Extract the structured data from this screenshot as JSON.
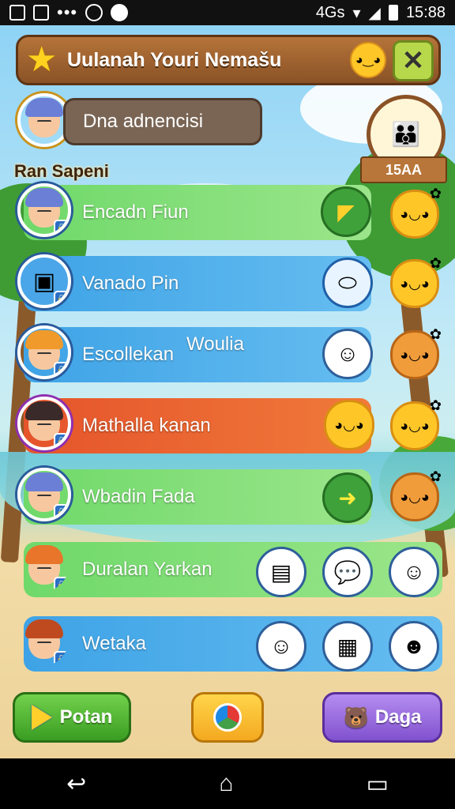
{
  "status_bar": {
    "network": "4Gs",
    "time": "15:88"
  },
  "header": {
    "title": "Uulanah Youri Nemašu",
    "title_icon": "star-icon",
    "close_icon": "close-icon"
  },
  "profile": {
    "label": "Dna adnencisi",
    "badge_text": "15AA"
  },
  "section_label": "Ran Sapeni",
  "rows": [
    {
      "label": "Encadn Fiun",
      "extra": "",
      "color": "#6fd96a"
    },
    {
      "label": "Vanado Pin",
      "extra": "",
      "color": "#3ea3e6"
    },
    {
      "label": "Escollekan",
      "extra": "Woulia",
      "color": "#3ea3e6"
    },
    {
      "label": "Mathalla kanan",
      "extra": "",
      "color": "#e5542b"
    },
    {
      "label": "Wbadin Fada",
      "extra": "",
      "color": "#6fd96a"
    },
    {
      "label": "Duralan Yarkan",
      "extra": "",
      "color": "#6fd96a"
    },
    {
      "label": "Wetaka",
      "extra": "",
      "color": "#3ea3e6"
    }
  ],
  "bottom_bar": {
    "left_button": "Potan",
    "right_button": "Daga"
  },
  "nav": {
    "back": "↩",
    "home": "⌂",
    "recents": "▭"
  }
}
